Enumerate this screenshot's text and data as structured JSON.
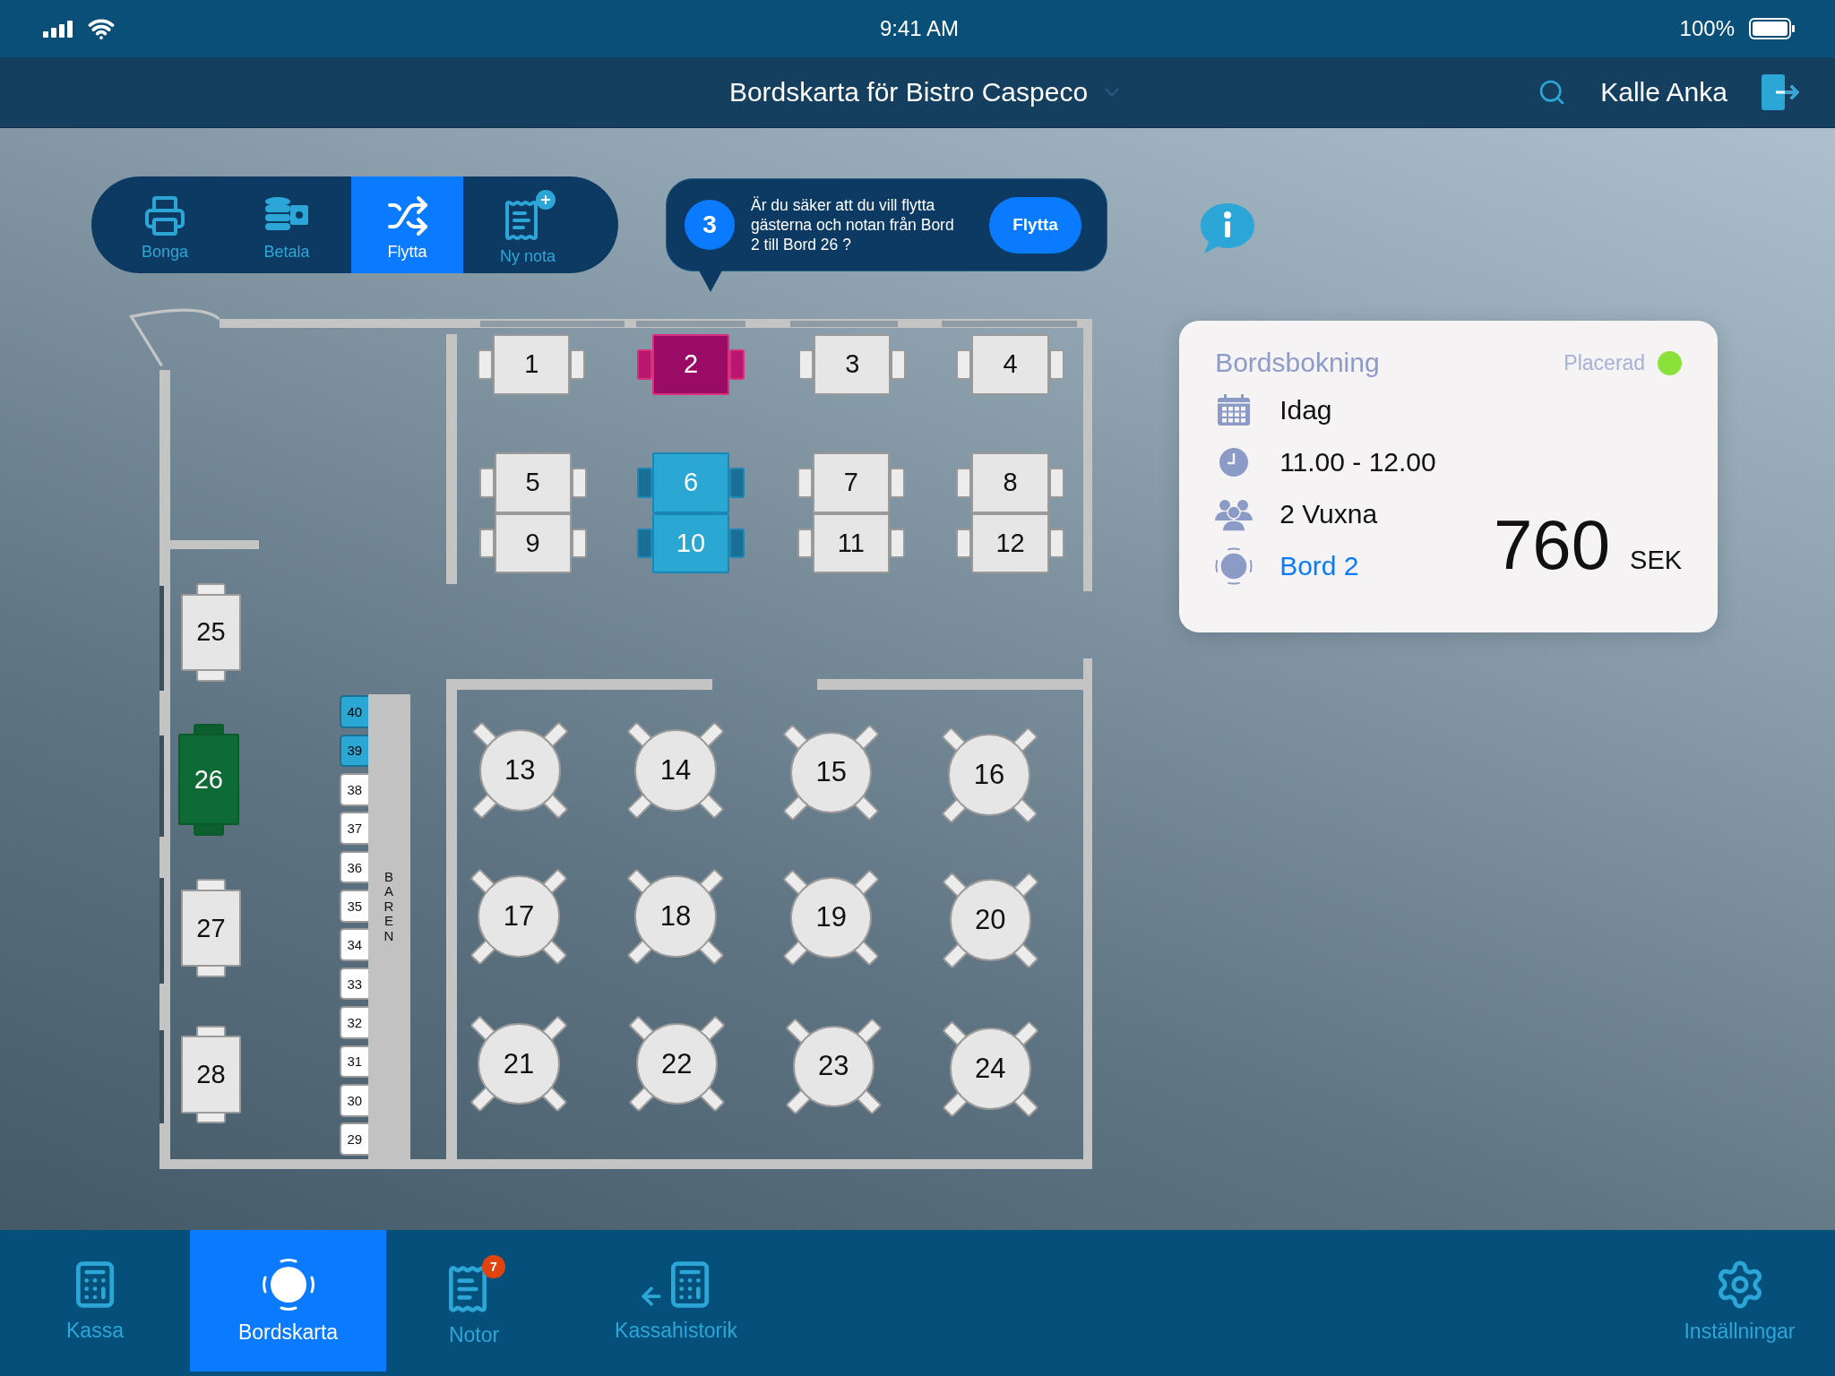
{
  "status_bar": {
    "time": "9:41 AM",
    "battery": "100%"
  },
  "nav_bar": {
    "title": "Bordskarta för Bistro Caspeco",
    "user": "Kalle Anka"
  },
  "toolbar": [
    {
      "label": "Bonga",
      "kind": "print",
      "selected": false
    },
    {
      "label": "Betala",
      "kind": "pay",
      "selected": false
    },
    {
      "label": "Flytta",
      "kind": "move",
      "selected": true
    },
    {
      "label": "Ny nota",
      "kind": "new_note",
      "selected": false
    }
  ],
  "confirm": {
    "step": "3",
    "message": "Är du säker att du vill flytta gästerna och notan från Bord 2 till Bord 26 ?",
    "button": "Flytta"
  },
  "floor": {
    "tables": [
      {
        "label": "1",
        "kind": "wide",
        "occupied": false,
        "selected": false,
        "target": false
      },
      {
        "label": "2",
        "kind": "wide",
        "occupied": false,
        "selected": true,
        "target": false
      },
      {
        "label": "3",
        "kind": "wide",
        "occupied": false,
        "selected": false,
        "target": false
      },
      {
        "label": "4",
        "kind": "wide",
        "occupied": false,
        "selected": false,
        "target": false
      },
      {
        "label": "5",
        "kind": "wide",
        "occupied": false,
        "selected": false,
        "target": false
      },
      {
        "label": "6",
        "kind": "wide",
        "occupied": true,
        "selected": false,
        "target": false
      },
      {
        "label": "7",
        "kind": "wide",
        "occupied": false,
        "selected": false,
        "target": false
      },
      {
        "label": "8",
        "kind": "wide",
        "occupied": false,
        "selected": false,
        "target": false
      },
      {
        "label": "9",
        "kind": "wide",
        "occupied": false,
        "selected": false,
        "target": false
      },
      {
        "label": "10",
        "kind": "wide",
        "occupied": true,
        "selected": false,
        "target": false
      },
      {
        "label": "11",
        "kind": "wide",
        "occupied": false,
        "selected": false,
        "target": false
      },
      {
        "label": "12",
        "kind": "wide",
        "occupied": false,
        "selected": false,
        "target": false
      },
      {
        "label": "13",
        "kind": "round",
        "occupied": false,
        "selected": false,
        "target": false
      },
      {
        "label": "14",
        "kind": "round",
        "occupied": false,
        "selected": false,
        "target": false
      },
      {
        "label": "15",
        "kind": "round",
        "occupied": false,
        "selected": false,
        "target": false
      },
      {
        "label": "16",
        "kind": "round",
        "occupied": false,
        "selected": false,
        "target": false
      },
      {
        "label": "17",
        "kind": "round",
        "occupied": false,
        "selected": false,
        "target": false
      },
      {
        "label": "18",
        "kind": "round",
        "occupied": false,
        "selected": false,
        "target": false
      },
      {
        "label": "19",
        "kind": "round",
        "occupied": false,
        "selected": false,
        "target": false
      },
      {
        "label": "20",
        "kind": "round",
        "occupied": false,
        "selected": false,
        "target": false
      },
      {
        "label": "21",
        "kind": "round",
        "occupied": false,
        "selected": false,
        "target": false
      },
      {
        "label": "22",
        "kind": "round",
        "occupied": false,
        "selected": false,
        "target": false
      },
      {
        "label": "23",
        "kind": "round",
        "occupied": false,
        "selected": false,
        "target": false
      },
      {
        "label": "24",
        "kind": "round",
        "occupied": false,
        "selected": false,
        "target": false
      },
      {
        "label": "25",
        "kind": "tall",
        "occupied": false,
        "selected": false,
        "target": false
      },
      {
        "label": "26",
        "kind": "tall",
        "occupied": false,
        "selected": false,
        "target": true
      },
      {
        "label": "27",
        "kind": "tall",
        "occupied": false,
        "selected": false,
        "target": false
      },
      {
        "label": "28",
        "kind": "tall",
        "occupied": false,
        "selected": false,
        "target": false
      }
    ],
    "bar": {
      "label": "BAREN",
      "seats": [
        {
          "label": "40",
          "occupied": true
        },
        {
          "label": "39",
          "occupied": true
        },
        {
          "label": "38",
          "occupied": false
        },
        {
          "label": "37",
          "occupied": false
        },
        {
          "label": "36",
          "occupied": false
        },
        {
          "label": "35",
          "occupied": false
        },
        {
          "label": "34",
          "occupied": false
        },
        {
          "label": "33",
          "occupied": false
        },
        {
          "label": "32",
          "occupied": false
        },
        {
          "label": "31",
          "occupied": false
        },
        {
          "label": "30",
          "occupied": false
        },
        {
          "label": "29",
          "occupied": false
        }
      ]
    }
  },
  "booking": {
    "title": "Bordsbokning",
    "status": {
      "label": "Placerad",
      "color": "#8be03a"
    },
    "rows": [
      {
        "kind": "calendar",
        "text": "Idag"
      },
      {
        "kind": "clock",
        "text": "11.00 - 12.00"
      },
      {
        "kind": "guests",
        "text": "2 Vuxna"
      },
      {
        "kind": "table",
        "text": "Bord 2"
      }
    ],
    "amount": "760",
    "currency": "SEK"
  },
  "tab_bar": [
    {
      "label": "Kassa",
      "kind": "register",
      "selected": false
    },
    {
      "label": "Bordskarta",
      "kind": "floor",
      "selected": true
    },
    {
      "label": "Notor",
      "kind": "notes",
      "selected": false,
      "badge": "7"
    },
    {
      "label": "Kassahistorik",
      "kind": "history",
      "selected": false
    },
    {
      "label": "Inställningar",
      "kind": "settings",
      "selected": false
    }
  ]
}
